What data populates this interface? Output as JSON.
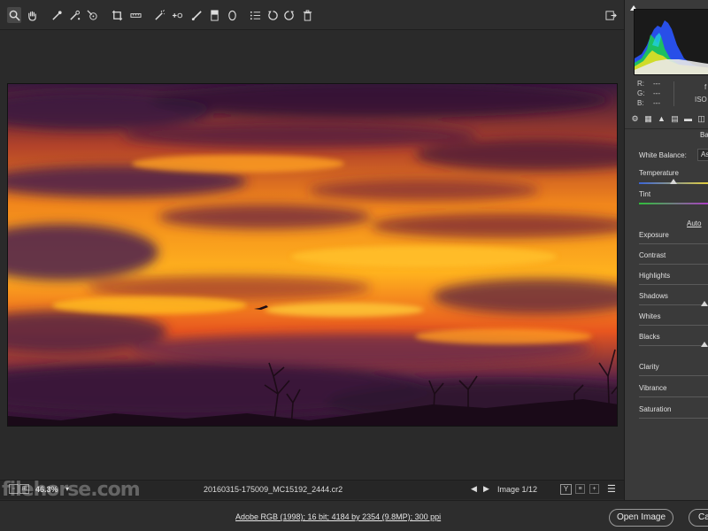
{
  "toolbar": {
    "tools": [
      {
        "name": "zoom-tool",
        "glyph": "🔍"
      },
      {
        "name": "hand-tool",
        "glyph": "✋"
      },
      {
        "name": "white-balance-tool",
        "glyph": "✒"
      },
      {
        "name": "color-sampler-tool",
        "glyph": "✒"
      },
      {
        "name": "targeted-adjustment-tool",
        "glyph": "⊕"
      },
      {
        "name": "crop-tool",
        "glyph": "⌗"
      },
      {
        "name": "straighten-tool",
        "glyph": "▭"
      },
      {
        "name": "spot-removal-tool",
        "glyph": "✎"
      },
      {
        "name": "red-eye-tool",
        "glyph": "+◦"
      },
      {
        "name": "adjustment-brush-tool",
        "glyph": "✐"
      },
      {
        "name": "graduated-filter-tool",
        "glyph": "▮"
      },
      {
        "name": "radial-filter-tool",
        "glyph": "◯"
      },
      {
        "name": "preferences-tool",
        "glyph": "☰"
      },
      {
        "name": "rotate-left-tool",
        "glyph": "↺"
      },
      {
        "name": "rotate-right-tool",
        "glyph": "↻"
      },
      {
        "name": "trash-tool",
        "glyph": "🗑"
      }
    ]
  },
  "status": {
    "zoom": "46.3%",
    "filename": "20160315-175009_MC15192_2444.cr2",
    "image_counter": "Image 1/12",
    "y_label": "Y"
  },
  "watermark": "filehorse.com",
  "bottom": {
    "workflow_link": "Adobe RGB (1998); 16 bit; 4184 by 2354 (9.8MP); 300 ppi",
    "open_image": "Open Image",
    "cancel": "Ca"
  },
  "panel": {
    "rgb": {
      "r_label": "R:",
      "g_label": "G:",
      "b_label": "B:",
      "r": "---",
      "g": "---",
      "b": "---"
    },
    "exif_f": "f",
    "exif_iso": "ISO",
    "section_title": "Ba",
    "white_balance_label": "White Balance:",
    "white_balance_value": "As",
    "temperature": "Temperature",
    "tint": "Tint",
    "auto": "Auto",
    "sliders": [
      "Exposure",
      "Contrast",
      "Highlights",
      "Shadows",
      "Whites",
      "Blacks"
    ],
    "presence": [
      "Clarity",
      "Vibrance",
      "Saturation"
    ]
  }
}
